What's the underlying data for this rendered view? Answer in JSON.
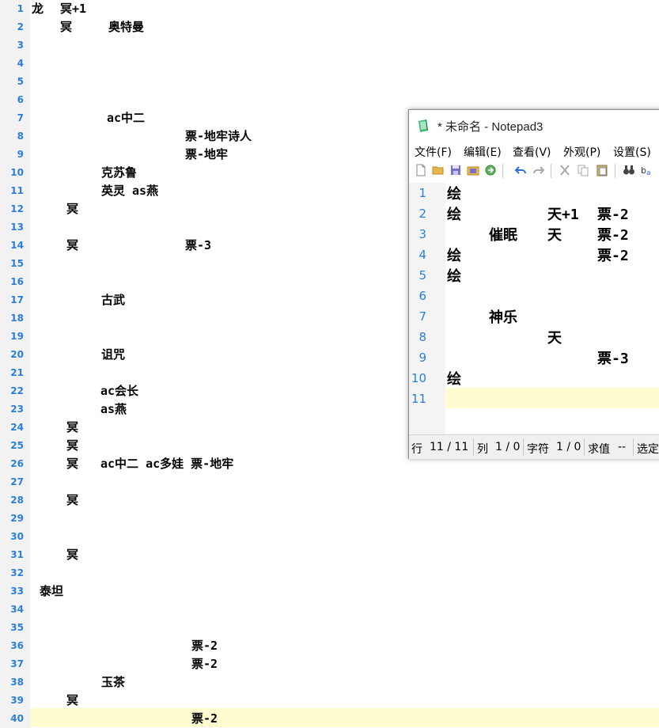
{
  "main_editor": {
    "line_numbers": [
      "1",
      "2",
      "3",
      "4",
      "5",
      "6",
      "7",
      "8",
      "9",
      "10",
      "11",
      "12",
      "13",
      "14",
      "15",
      "16",
      "17",
      "18",
      "19",
      "20",
      "21",
      "22",
      "23",
      "24",
      "25",
      "26",
      "27",
      "28",
      "29",
      "30",
      "31",
      "32",
      "33",
      "34",
      "35",
      "36",
      "37",
      "38",
      "39",
      "40"
    ],
    "texts": {
      "l1a": "龙",
      "l1b": "冥+1",
      "l2a": "冥",
      "l2b": "奥特曼",
      "l7": "ac中二",
      "l8": "票-地牢诗人",
      "l9": "票-地牢",
      "l10": "克苏鲁",
      "l11": "英灵 as燕",
      "l12": "冥",
      "l14a": "冥",
      "l14b": "票-3",
      "l17": "古武",
      "l20": "诅咒",
      "l22": "ac会长",
      "l23": "as燕",
      "l24": "冥",
      "l25": "冥",
      "l26a": "冥",
      "l26b": "ac中二 ac多娃 票-地牢",
      "l28": "冥",
      "l31": "冥",
      "l33": "泰坦",
      "l36": "票-2",
      "l37": "票-2",
      "l38": "玉茶",
      "l39": "冥",
      "l40": "票-2"
    }
  },
  "notepad": {
    "title": "* 未命名 - Notepad3",
    "menu": {
      "file": "文件(F)",
      "edit": "编辑(E)",
      "view": "查看(V)",
      "appearance": "外观(P)",
      "settings": "设置(S)"
    },
    "line_numbers": [
      "1",
      "2",
      "3",
      "4",
      "5",
      "6",
      "7",
      "8",
      "9",
      "10",
      "11"
    ],
    "texts": {
      "n1": "绘",
      "n2a": "绘",
      "n2b": "天+1",
      "n2c": "票-2",
      "n3a": "催眠",
      "n3b": "天",
      "n3c": "票-2",
      "n4a": "绘",
      "n4b": "票-2",
      "n5": "绘",
      "n7": "神乐",
      "n8": "天",
      "n9": "票-3",
      "n10": "绘"
    },
    "status": {
      "line_label": "行",
      "line_value": "11 / 11",
      "col_label": "列",
      "col_value": "1 / 0",
      "char_label": "字符",
      "char_value": "1 / 0",
      "eval_label": "求值",
      "eval_value": "--",
      "selection_label": "选定"
    }
  },
  "colors": {
    "line_number": "#2b7fd9",
    "current_line": "#fffcd0",
    "gutter": "#f2f2f2"
  }
}
